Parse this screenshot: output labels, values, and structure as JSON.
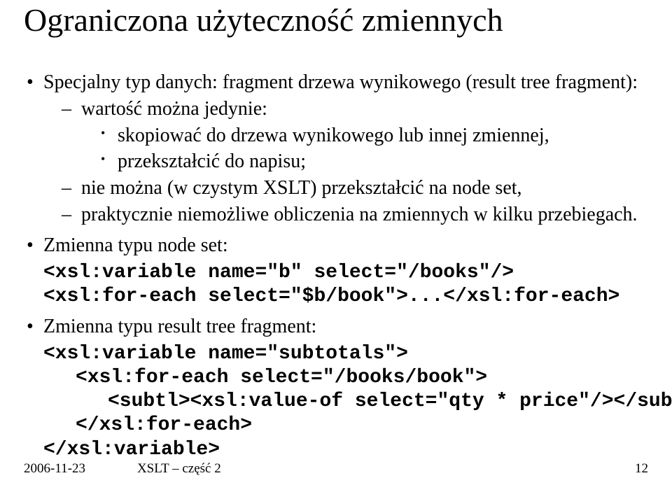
{
  "title": "Ograniczona użyteczność zmiennych",
  "bullet1": {
    "lead": "Specjalny typ danych: fragment drzewa wynikowego (result tree fragment):",
    "sub1": {
      "lead": "wartość można jedynie:",
      "a": "skopiować do drzewa wynikowego lub innej zmiennej,",
      "b": "przekształcić do napisu;"
    },
    "sub2": "nie można (w czystym XSLT) przekształcić na node set,",
    "sub3": "praktycznie niemożliwe obliczenia na zmiennych w kilku przebiegach."
  },
  "bullet2": {
    "lead": "Zmienna typu node set:",
    "code1": "<xsl:variable name=\"b\" select=\"/books\"/>",
    "code2": "<xsl:for-each select=\"$b/book\">...</xsl:for-each>"
  },
  "bullet3": {
    "lead": "Zmienna typu result tree fragment:",
    "code1": "<xsl:variable name=\"subtotals\">",
    "code2": "<xsl:for-each select=\"/books/book\">",
    "code3": "<subtl><xsl:value-of select=\"qty * price\"/></subtl>",
    "code4": "</xsl:for-each>",
    "code5": "</xsl:variable>"
  },
  "footer": {
    "date": "2006-11-23",
    "title": "XSLT – część 2",
    "page": "12"
  }
}
